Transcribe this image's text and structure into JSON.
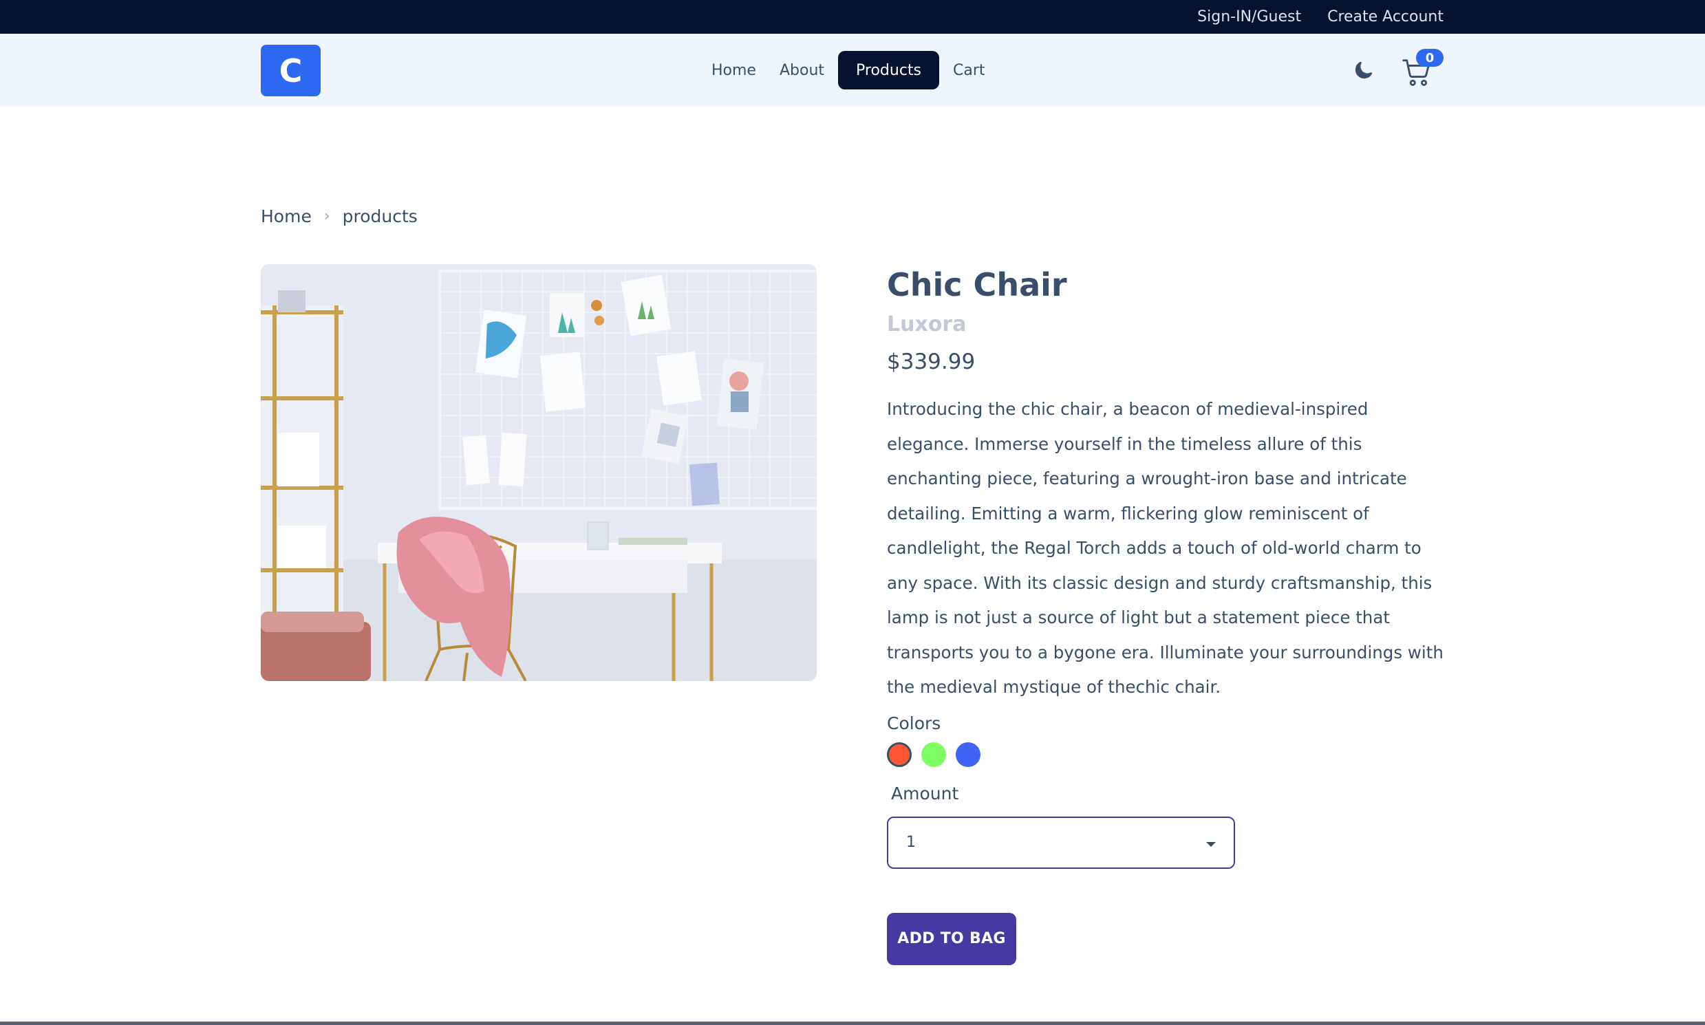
{
  "topbar": {
    "signin": "Sign-IN/Guest",
    "create_account": "Create Account"
  },
  "navbar": {
    "logo_letter": "C",
    "links": [
      "Home",
      "About",
      "Products",
      "Cart"
    ],
    "active": "Products",
    "cart_count": "0",
    "icons": [
      "moon-icon",
      "cart-icon"
    ],
    "accent": "#2d69f0",
    "dark": "#061230"
  },
  "breadcrumb": {
    "home": "Home",
    "current": "products"
  },
  "product": {
    "title": "Chic Chair",
    "company": "Luxora",
    "price": "$339.99",
    "description": "Introducing the chic chair, a beacon of medieval-inspired elegance. Immerse yourself in the timeless allure of this enchanting piece, featuring a wrought-iron base and intricate detailing. Emitting a warm, flickering glow reminiscent of candlelight, the Regal Torch adds a touch of old-world charm to any space. With its classic design and sturdy craftsmanship, this lamp is not just a source of light but a statement piece that transports you to a bygone era. Illuminate your surroundings with the medieval mystique of thechic chair.",
    "colors_label": "Colors",
    "colors": [
      "#ff5733",
      "#7dff63",
      "#3f63f2"
    ],
    "selected_color": "#ff5733",
    "amount_label": "Amount",
    "amount_value": "1",
    "add_button": "ADD TO BAG",
    "button_color": "#463aa2"
  }
}
